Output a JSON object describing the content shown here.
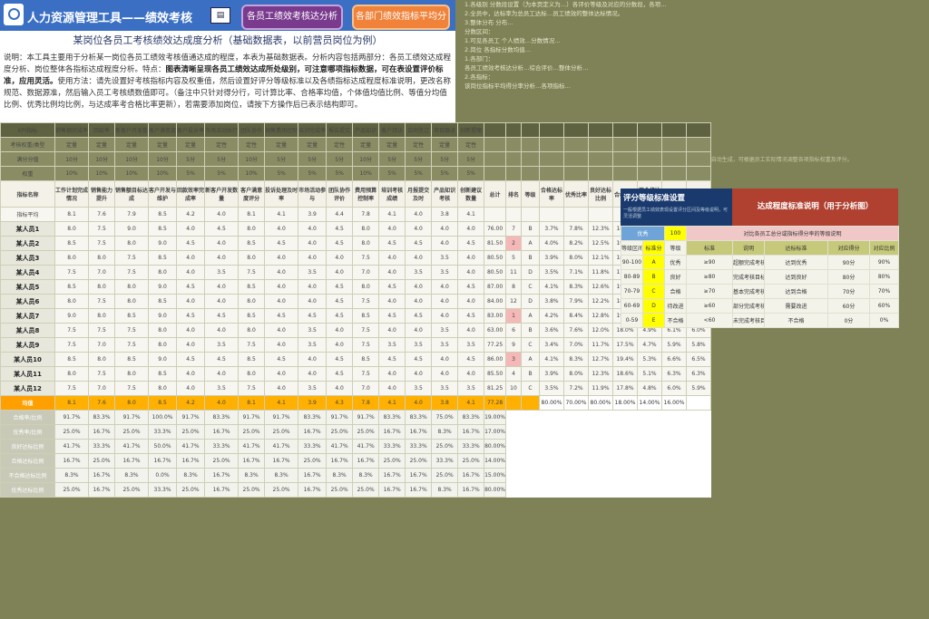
{
  "header": {
    "title": "人力资源管理工具——绩效考核",
    "button_analysis": "各员工绩效考核达分析",
    "button_dept": "各部门绩效指标平均分析"
  },
  "heading": "某岗位各员工考核绩效达成度分析（基础数据表，以前营员岗位为例）",
  "description": {
    "intro": "说明：本工具主要用于分析某一岗位各员工绩效考核值通达成的程度，本表为基础数据表。分析内容包括两部分：各员工绩效达成程度分析、岗位整体各指标达成程度分析。特点：",
    "bold1": "图表清晰呈现各员工绩效达成所处级别，可注意哪项指标数据，可在表设置评价标准，应用灵活。",
    "method": "使用方法：请先设置好考核指标内容及权重值，然后设置好评分等级标准以及各绩指标达成程度标准说明，更改名称规范、数据源准，然后输入员工考核绩数值即可。",
    "note": "（备注中只针对得分行，可计算比率、合格率均值，个体值均值比例、等值分均值比例、优秀比例均比例，与达成率考合格比率更新），若需要添加岗位，请按下方操作后已表示结构即可。"
  },
  "right_notes": [
    "1.各级别 分数段设置（为本页定义为…）各评价等级及对应的分数段，各项…",
    "2.全员中，达标率为总员工达标…员工绩效的整体达标情况。",
    "3.整体分布 分布…",
    "分数区间：",
    "1.可见各员工 个人绩效…分数情况…",
    "2.岗位  各指标分数均值…",
    "1.各部门：",
    "各员工绩效考核达分析…综合评价…整体分析…",
    "2.各指标：",
    "该岗位指标平均得分率分析…各项指标…"
  ],
  "right_note_small": "1.以上分析数据根据员工考核表填写后自动生成，可根据员工实际情况调整各项指标权重及评分。",
  "table": {
    "label_kpi": "KPI指标",
    "label_weight_type": "考核权重/类型",
    "label_max": "满分分值",
    "label_weight": "权重",
    "label_item": "指标名称",
    "label_avg_row": "指标平均",
    "label_total": "总计",
    "label_rank": "排名",
    "label_grade": "等级",
    "kpi_headers": [
      "销售额完成率",
      "回款率",
      "新客户开发数",
      "客户满意度",
      "客户投诉率",
      "市场活动执行",
      "团队协作",
      "销售费用控制",
      "培训完成率",
      "报告提交",
      "产品知识",
      "客户拜访",
      "合同签订",
      "项目跟进",
      "创新提案"
    ],
    "item_headers": [
      "工作计划完成情况",
      "销售能力提升",
      "销售额目标达成",
      "客户开发与维护",
      "回款效率完成率",
      "新客户开发数量",
      "客户满意度评分",
      "投诉处理及时率",
      "市场活动参与",
      "团队协作评价",
      "费用预算控制率",
      "培训考核成绩",
      "月报提交及时",
      "产品知识考核",
      "创新建议数量"
    ],
    "extra_headers": [
      "总计",
      "排名",
      "等级",
      "合格达标率",
      "优秀比率",
      "良好达标比例",
      "合格比例",
      "不合格比例",
      "优秀比例",
      "及格比例"
    ],
    "type_row": [
      "定量",
      "定量",
      "定量",
      "定量",
      "定量",
      "定性",
      "定性",
      "定量",
      "定量",
      "定性",
      "定量",
      "定量",
      "定性",
      "定量",
      "定性"
    ],
    "max_row": [
      "10分",
      "10分",
      "10分",
      "10分",
      "5分",
      "5分",
      "10分",
      "5分",
      "5分",
      "5分",
      "10分",
      "5分",
      "5分",
      "5分",
      "5分"
    ],
    "weight_row": [
      "10%",
      "10%",
      "10%",
      "10%",
      "5%",
      "5%",
      "10%",
      "5%",
      "5%",
      "5%",
      "10%",
      "5%",
      "5%",
      "5%",
      "5%"
    ],
    "avg_row": [
      "8.1",
      "7.6",
      "7.9",
      "8.5",
      "4.2",
      "4.0",
      "8.1",
      "4.1",
      "3.9",
      "4.4",
      "7.8",
      "4.1",
      "4.0",
      "3.8",
      "4.1"
    ],
    "employees": [
      {
        "name": "某人员1",
        "scores": [
          "8.0",
          "7.5",
          "9.0",
          "8.5",
          "4.0",
          "4.5",
          "8.0",
          "4.0",
          "4.0",
          "4.5",
          "8.0",
          "4.0",
          "4.0",
          "4.0",
          "4.0"
        ],
        "total": "76.00",
        "rank": "7",
        "grade": "B",
        "rates": [
          "3.7%",
          "7.8%",
          "12.3%",
          "18.5%",
          "5.0%",
          "6.2%",
          "6.2%"
        ]
      },
      {
        "name": "某人员2",
        "scores": [
          "8.5",
          "7.5",
          "8.0",
          "9.0",
          "4.5",
          "4.0",
          "8.5",
          "4.5",
          "4.0",
          "4.5",
          "8.0",
          "4.5",
          "4.5",
          "4.0",
          "4.5"
        ],
        "total": "81.50",
        "rank": "2",
        "grade": "A",
        "rates": [
          "4.0%",
          "8.2%",
          "12.5%",
          "19.0%",
          "5.2%",
          "6.5%",
          "6.4%"
        ]
      },
      {
        "name": "某人员3",
        "scores": [
          "8.0",
          "8.0",
          "7.5",
          "8.5",
          "4.0",
          "4.0",
          "8.0",
          "4.0",
          "4.0",
          "4.0",
          "7.5",
          "4.0",
          "4.0",
          "3.5",
          "4.0"
        ],
        "total": "80.50",
        "rank": "5",
        "grade": "B",
        "rates": [
          "3.9%",
          "8.0%",
          "12.1%",
          "18.2%",
          "5.1%",
          "6.3%",
          "6.1%"
        ]
      },
      {
        "name": "某人员4",
        "scores": [
          "7.5",
          "7.0",
          "7.5",
          "8.0",
          "4.0",
          "3.5",
          "7.5",
          "4.0",
          "3.5",
          "4.0",
          "7.0",
          "4.0",
          "3.5",
          "3.5",
          "4.0"
        ],
        "total": "80.50",
        "rank": "11",
        "grade": "D",
        "rates": [
          "3.5%",
          "7.1%",
          "11.8%",
          "17.6%",
          "4.8%",
          "6.0%",
          "5.9%"
        ]
      },
      {
        "name": "某人员5",
        "scores": [
          "8.5",
          "8.0",
          "8.0",
          "9.0",
          "4.5",
          "4.0",
          "8.5",
          "4.0",
          "4.0",
          "4.5",
          "8.0",
          "4.5",
          "4.0",
          "4.0",
          "4.5"
        ],
        "total": "87.00",
        "rank": "8",
        "grade": "C",
        "rates": [
          "4.1%",
          "8.3%",
          "12.6%",
          "19.3%",
          "5.3%",
          "6.6%",
          "6.5%"
        ]
      },
      {
        "name": "某人员6",
        "scores": [
          "8.0",
          "7.5",
          "8.0",
          "8.5",
          "4.0",
          "4.0",
          "8.0",
          "4.0",
          "4.0",
          "4.5",
          "7.5",
          "4.0",
          "4.0",
          "4.0",
          "4.0"
        ],
        "total": "84.00",
        "rank": "12",
        "grade": "D",
        "rates": [
          "3.8%",
          "7.9%",
          "12.2%",
          "18.4%",
          "5.0%",
          "6.2%",
          "6.2%"
        ]
      },
      {
        "name": "某人员7",
        "scores": [
          "9.0",
          "8.0",
          "8.5",
          "9.0",
          "4.5",
          "4.5",
          "8.5",
          "4.5",
          "4.5",
          "4.5",
          "8.5",
          "4.5",
          "4.5",
          "4.0",
          "4.5"
        ],
        "total": "83.00",
        "rank": "1",
        "grade": "A",
        "rates": [
          "4.2%",
          "8.4%",
          "12.8%",
          "19.5%",
          "5.4%",
          "6.7%",
          "6.6%"
        ]
      },
      {
        "name": "某人员8",
        "scores": [
          "7.5",
          "7.5",
          "7.5",
          "8.0",
          "4.0",
          "4.0",
          "8.0",
          "4.0",
          "3.5",
          "4.0",
          "7.5",
          "4.0",
          "4.0",
          "3.5",
          "4.0"
        ],
        "total": "63.00",
        "rank": "6",
        "grade": "B",
        "rates": [
          "3.6%",
          "7.6%",
          "12.0%",
          "18.0%",
          "4.9%",
          "6.1%",
          "6.0%"
        ]
      },
      {
        "name": "某人员9",
        "scores": [
          "7.5",
          "7.0",
          "7.5",
          "8.0",
          "4.0",
          "3.5",
          "7.5",
          "4.0",
          "3.5",
          "4.0",
          "7.5",
          "3.5",
          "3.5",
          "3.5",
          "3.5"
        ],
        "total": "77.25",
        "rank": "9",
        "grade": "C",
        "rates": [
          "3.4%",
          "7.0%",
          "11.7%",
          "17.5%",
          "4.7%",
          "5.9%",
          "5.8%"
        ]
      },
      {
        "name": "某人员10",
        "scores": [
          "8.5",
          "8.0",
          "8.5",
          "9.0",
          "4.5",
          "4.5",
          "8.5",
          "4.5",
          "4.0",
          "4.5",
          "8.5",
          "4.5",
          "4.5",
          "4.0",
          "4.5"
        ],
        "total": "86.00",
        "rank": "3",
        "grade": "A",
        "rates": [
          "4.1%",
          "8.3%",
          "12.7%",
          "19.4%",
          "5.3%",
          "6.6%",
          "6.5%"
        ]
      },
      {
        "name": "某人员11",
        "scores": [
          "8.0",
          "7.5",
          "8.0",
          "8.5",
          "4.0",
          "4.0",
          "8.0",
          "4.0",
          "4.0",
          "4.5",
          "7.5",
          "4.0",
          "4.0",
          "4.0",
          "4.0"
        ],
        "total": "85.50",
        "rank": "4",
        "grade": "B",
        "rates": [
          "3.9%",
          "8.0%",
          "12.3%",
          "18.6%",
          "5.1%",
          "6.3%",
          "6.3%"
        ]
      },
      {
        "name": "某人员12",
        "scores": [
          "7.5",
          "7.0",
          "7.5",
          "8.0",
          "4.0",
          "3.5",
          "7.5",
          "4.0",
          "3.5",
          "4.0",
          "7.0",
          "4.0",
          "3.5",
          "3.5",
          "3.5"
        ],
        "total": "81.25",
        "rank": "10",
        "grade": "C",
        "rates": [
          "3.5%",
          "7.2%",
          "11.9%",
          "17.8%",
          "4.8%",
          "6.0%",
          "5.9%"
        ]
      }
    ],
    "average": {
      "name": "均值",
      "scores": [
        "8.1",
        "7.6",
        "8.0",
        "8.5",
        "4.2",
        "4.0",
        "8.1",
        "4.1",
        "3.9",
        "4.3",
        "7.8",
        "4.1",
        "4.0",
        "3.8",
        "4.1"
      ],
      "total": "77.28",
      "rank": "",
      "grade": "",
      "rates": [
        "80.00%",
        "70.00%",
        "80.00%",
        "18.00%",
        "14.00%",
        "16.00%",
        ""
      ]
    },
    "footer_rows": [
      {
        "name": "合格率/比例",
        "values": [
          "91.7%",
          "83.3%",
          "91.7%",
          "100.0%",
          "91.7%",
          "83.3%",
          "91.7%",
          "91.7%",
          "83.3%",
          "91.7%",
          "91.7%",
          "83.3%",
          "83.3%",
          "75.0%",
          "83.3%"
        ],
        "total": "19.00%"
      },
      {
        "name": "优秀率/比例",
        "values": [
          "25.0%",
          "16.7%",
          "25.0%",
          "33.3%",
          "25.0%",
          "16.7%",
          "25.0%",
          "25.0%",
          "16.7%",
          "25.0%",
          "25.0%",
          "16.7%",
          "16.7%",
          "8.3%",
          "16.7%"
        ],
        "total": "17.00%"
      },
      {
        "name": "良好达标比例",
        "values": [
          "41.7%",
          "33.3%",
          "41.7%",
          "50.0%",
          "41.7%",
          "33.3%",
          "41.7%",
          "41.7%",
          "33.3%",
          "41.7%",
          "41.7%",
          "33.3%",
          "33.3%",
          "25.0%",
          "33.3%"
        ],
        "total": "80.00%"
      },
      {
        "name": "合格达标比例",
        "values": [
          "16.7%",
          "25.0%",
          "16.7%",
          "16.7%",
          "16.7%",
          "25.0%",
          "16.7%",
          "16.7%",
          "25.0%",
          "16.7%",
          "16.7%",
          "25.0%",
          "25.0%",
          "33.3%",
          "25.0%"
        ],
        "total": "14.00%"
      },
      {
        "name": "不合格达标比例",
        "values": [
          "8.3%",
          "16.7%",
          "8.3%",
          "0.0%",
          "8.3%",
          "16.7%",
          "8.3%",
          "8.3%",
          "16.7%",
          "8.3%",
          "8.3%",
          "16.7%",
          "16.7%",
          "25.0%",
          "16.7%"
        ],
        "total": "15.00%"
      },
      {
        "name": "优秀达标比例",
        "values": [
          "25.0%",
          "16.7%",
          "25.0%",
          "33.3%",
          "25.0%",
          "16.7%",
          "25.0%",
          "25.0%",
          "16.7%",
          "25.0%",
          "25.0%",
          "16.7%",
          "16.7%",
          "8.3%",
          "16.7%"
        ],
        "total": "80.00%"
      }
    ]
  },
  "panel": {
    "left_title": "评分等级标准设置",
    "left_sub": "一般根据员工绩效表现设置评分区间及等级说明，可灵活调整",
    "right_title": "达成程度标准说明（用于分析图）",
    "select_label": "优秀",
    "select_value": "100",
    "right_desc": "对比各员工总分或指标得分率的等级说明",
    "col_headers": [
      "等级区间",
      "标准分",
      "等级",
      "标准",
      "说明",
      "达标标准",
      "对应得分",
      "对应比例"
    ],
    "rows": [
      {
        "range": "90-100",
        "score": "A",
        "grade": "优秀",
        "std": "≥90",
        "desc": "超额完成考核目标",
        "target": "达到优秀",
        "pts": "90分",
        "pct": "90%"
      },
      {
        "range": "80-89",
        "score": "B",
        "grade": "良好",
        "std": "≥80",
        "desc": "完成考核目标",
        "target": "达到良好",
        "pts": "80分",
        "pct": "80%"
      },
      {
        "range": "70-79",
        "score": "C",
        "grade": "合格",
        "std": "≥70",
        "desc": "基本完成考核目标",
        "target": "达到合格",
        "pts": "70分",
        "pct": "70%"
      },
      {
        "range": "60-69",
        "score": "D",
        "grade": "待改进",
        "std": "≥60",
        "desc": "部分完成考核目标",
        "target": "需要改进",
        "pts": "60分",
        "pct": "60%"
      },
      {
        "range": "0-59",
        "score": "E",
        "grade": "不合格",
        "std": "<60",
        "desc": "未完成考核目标",
        "target": "不合格",
        "pts": "0分",
        "pct": "0%"
      }
    ]
  }
}
